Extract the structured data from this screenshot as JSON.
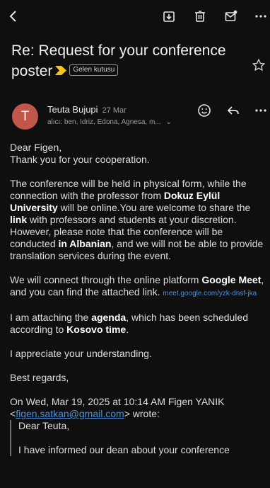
{
  "colors": {
    "background": "#0f0f0f",
    "avatar": "#c0574a",
    "link": "#4f8fd8",
    "important": "#f5c518"
  },
  "toolbar": {
    "icons": [
      "back-arrow-icon",
      "archive-icon",
      "trash-icon",
      "mark-unread-icon",
      "more-options-icon"
    ]
  },
  "email": {
    "subject": "Re: Request for your conference poster",
    "label": "Gelen kutusu",
    "sender": "Teuta Bujupi",
    "date": "27 Mar",
    "recipients": "alıcı: ben, Idriz, Edona, Agnesa, m...",
    "body": {
      "greeting": "Dear Figen,",
      "thanks": "Thank you for your cooperation.",
      "p1_a": "The conference will be held in physical form, while the connection with the professor from ",
      "p1_b": "Dokuz Eylül University",
      "p1_c": " will be online.You are welcome to share the ",
      "p1_d": "link",
      "p1_e": " with professors and students at your discretion. However, please note that the conference will be conducted ",
      "p1_f": "in Albanian",
      "p1_g": ", and we will not be able to provide translation services during the event.",
      "p2_a": "We will connect through the online platform ",
      "p2_b": "Google Meet",
      "p2_c": ", and you can find the attached link. ",
      "p2_link": "meet.google.com/yzk-dnsf-jka",
      "p3_a": "I am attaching the ",
      "p3_b": "agenda",
      "p3_c": ", which has been scheduled according to ",
      "p3_d": "Kosovo time",
      "p3_e": ".",
      "p4": "I appreciate your understanding.",
      "p5": "Best regards,",
      "quote_header_a": "On Wed, Mar 19, 2025 at 10:14 AM Figen YANIK <",
      "quote_email": "figen.satkan@gmail.com",
      "quote_header_b": "> wrote:",
      "quote_greeting": "Dear Teuta,",
      "quote_line": "I have informed our dean about your conference"
    }
  }
}
